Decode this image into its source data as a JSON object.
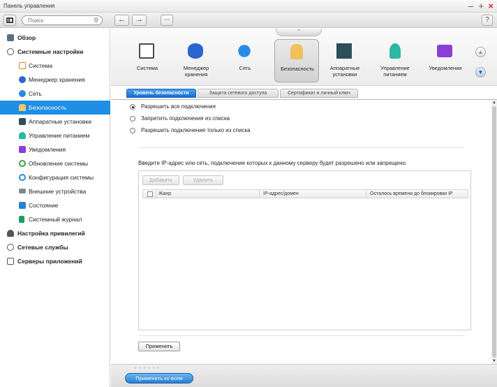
{
  "window": {
    "title": "Панель управления"
  },
  "toolbar": {
    "search_placeholder": "Поиск",
    "back": "←",
    "forward": "→",
    "apps": "⋯",
    "help": "?"
  },
  "sidebar": {
    "top1": "Обзор",
    "top2": "Системные настройки",
    "sub": [
      "Система",
      "Менеджер хранения",
      "Сеть",
      "Безопасность",
      "Аппаратные установки",
      "Управление питанием",
      "Уведомления",
      "Обновление системы",
      "Конфигурация системы",
      "Внешние устройства",
      "Состояние",
      "Системный журнал"
    ],
    "bottom": [
      "Настройка привилегий",
      "Сетевые службы",
      "Серверы приложений"
    ],
    "active": "Безопасность"
  },
  "apps": [
    {
      "label": "Система"
    },
    {
      "label": "Менеджер хранения"
    },
    {
      "label": "Сеть"
    },
    {
      "label": "Безопасность"
    },
    {
      "label": "Аппаратные установки"
    },
    {
      "label": "Управление питанием"
    },
    {
      "label": "Уведомления"
    }
  ],
  "tabs": [
    "Уровень безопасности",
    "Защита сетевого доступа",
    "Сертификат и личный ключ"
  ],
  "radios": [
    {
      "label": "Разрешить все подключения",
      "checked": true
    },
    {
      "label": "Запретить подключения из списка",
      "checked": false
    },
    {
      "label": "Разрешить подключения только из списка",
      "checked": false
    }
  ],
  "info_text": "Введите IP-адрес или сеть, подключение которых к данному серверу будет разрешено или запрещено.",
  "table": {
    "add_label": "Добавить",
    "remove_label": "Удалить",
    "columns": [
      "Жанр",
      "IP-адрес/домен",
      "Осталось времени до блокировки IP"
    ]
  },
  "apply_label": "Применить",
  "apply_all_label": "Применить ко всем",
  "colors": {
    "accent": "#1f8fe5",
    "close": "#dd2222"
  }
}
